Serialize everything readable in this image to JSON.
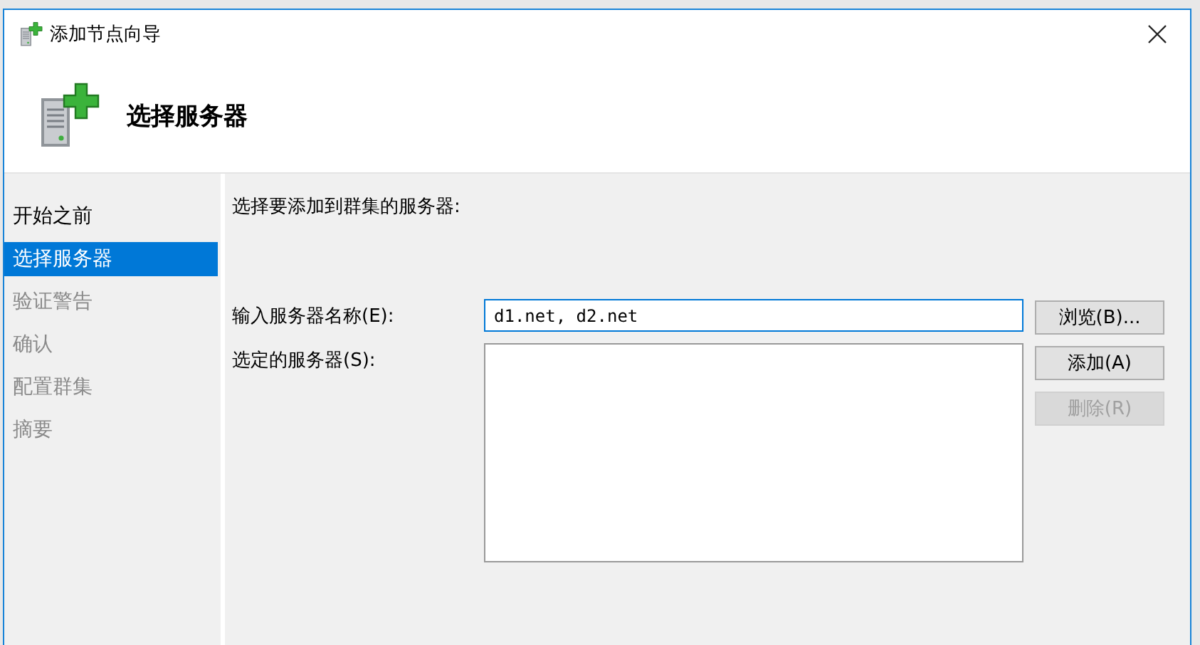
{
  "window": {
    "title": "添加节点向导"
  },
  "header": {
    "title": "选择服务器"
  },
  "sidebar": {
    "items": [
      {
        "label": "开始之前",
        "selected": false,
        "disabled": false
      },
      {
        "label": "选择服务器",
        "selected": true,
        "disabled": false
      },
      {
        "label": "验证警告",
        "selected": false,
        "disabled": true
      },
      {
        "label": "确认",
        "selected": false,
        "disabled": true
      },
      {
        "label": "配置群集",
        "selected": false,
        "disabled": true
      },
      {
        "label": "摘要",
        "selected": false,
        "disabled": true
      }
    ]
  },
  "content": {
    "instruction": "选择要添加到群集的服务器:",
    "server_name": {
      "label": "输入服务器名称(E):",
      "value": "d1.net, d2.net"
    },
    "selected_servers": {
      "label": "选定的服务器(S):"
    },
    "buttons": [
      {
        "label": "浏览(B)...",
        "disabled": false
      },
      {
        "label": "添加(A)",
        "disabled": false
      },
      {
        "label": "删除(R)",
        "disabled": true
      }
    ]
  }
}
